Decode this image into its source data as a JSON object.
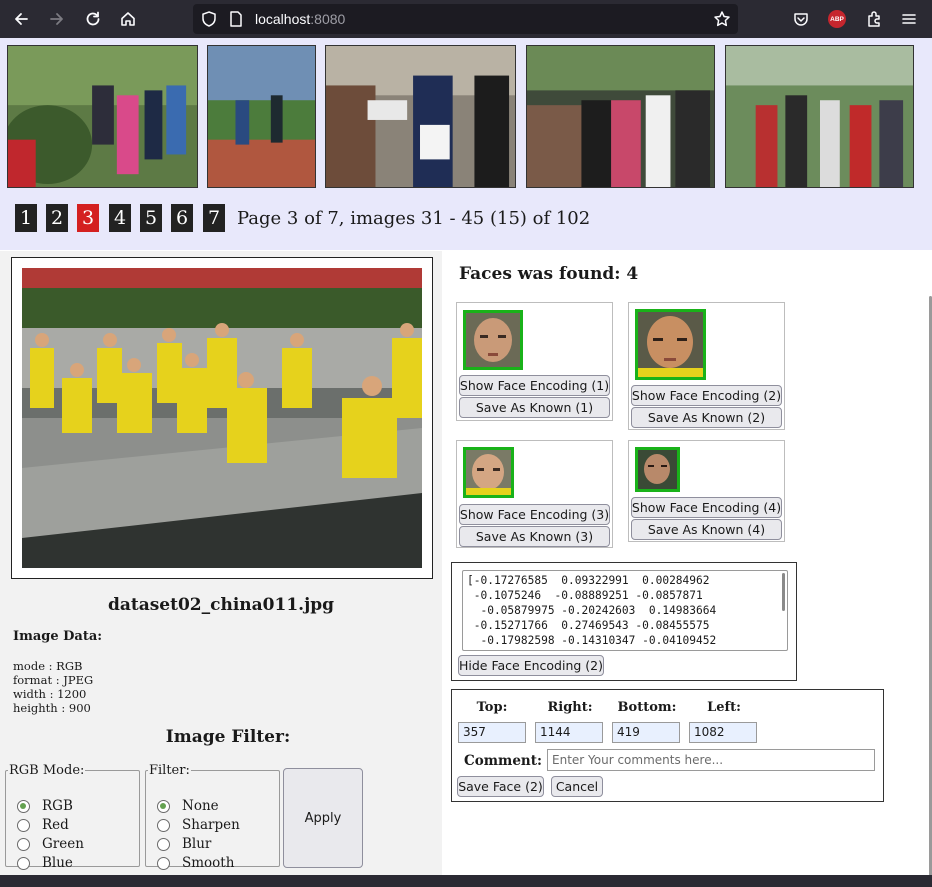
{
  "browser": {
    "url_host": "localhost",
    "url_port": ":8080",
    "abp_label": "ABP"
  },
  "pagination": {
    "pages": [
      "1",
      "2",
      "3",
      "4",
      "5",
      "6",
      "7"
    ],
    "current": "3",
    "info": "Page 3 of 7, images 31 - 45 (15) of 102"
  },
  "image": {
    "file_name": "dataset02_china011.jpg",
    "data_title": "Image Data:",
    "data_lines": [
      "mode : RGB",
      "format : JPEG",
      "width : 1200",
      "heighth : 900"
    ]
  },
  "filter": {
    "title": "Image Filter:",
    "rgb_legend": "RGB Mode:",
    "rgb_options": [
      "RGB",
      "Red",
      "Green",
      "Blue"
    ],
    "rgb_selected": "RGB",
    "filter_legend": "Filter:",
    "filter_options": [
      "None",
      "Sharpen",
      "Blur",
      "Smooth"
    ],
    "filter_selected": "None",
    "apply_label": "Apply"
  },
  "faces": {
    "title": "Faces was found: 4",
    "cards": [
      {
        "show_label": "Show Face Encoding (1)",
        "save_label": "Save As Known (1)"
      },
      {
        "show_label": "Show Face Encoding (2)",
        "save_label": "Save As Known (2)"
      },
      {
        "show_label": "Show Face Encoding (3)",
        "save_label": "Save As Known (3)"
      },
      {
        "show_label": "Show Face Encoding (4)",
        "save_label": "Save As Known (4)"
      }
    ]
  },
  "encoding": {
    "text": "[-0.17276585  0.09322991  0.00284962\n -0.1075246  -0.08889251 -0.0857871\n  -0.05879975 -0.20242603  0.14983664\n -0.15271766  0.27469543 -0.08455575\n  -0.17982598 -0.14310347 -0.04109452",
    "hide_label": "Hide Face Encoding (2)"
  },
  "face_edit": {
    "top_label": "Top:",
    "right_label": "Right:",
    "bottom_label": "Bottom:",
    "left_label": "Left:",
    "top": "357",
    "right": "1144",
    "bottom": "419",
    "left": "1082",
    "comment_label": "Comment:",
    "comment_placeholder": "Enter Your comments here...",
    "save_label": "Save Face (2)",
    "cancel_label": "Cancel"
  },
  "colors": {
    "gallery_bg": "#e8e8fb",
    "active_page": "#d42020",
    "face_border": "#19b219",
    "chrome_bg": "#2b2a33"
  }
}
